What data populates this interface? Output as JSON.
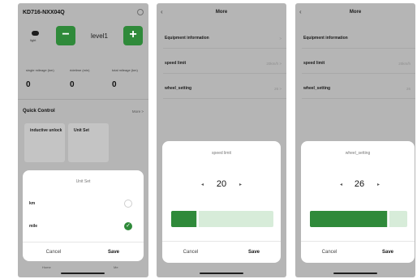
{
  "phone1": {
    "device_title": "KD716-NXX04Q",
    "light_label": "light",
    "level_label": "level1",
    "minus_label": "−",
    "plus_label": "+",
    "stats": [
      {
        "label": "single mileage (km)",
        "value": "0"
      },
      {
        "label": "ridetime (min)",
        "value": "0"
      },
      {
        "label": "total mileage (km)",
        "value": "0"
      }
    ],
    "quick_control": {
      "title": "Quick Control",
      "more": "More >"
    },
    "quick_cards": [
      {
        "label": "inductive unlock"
      },
      {
        "label": "Unit Set"
      }
    ],
    "unit_sheet": {
      "title": "Unit Set",
      "options": [
        {
          "label": "km",
          "selected": false
        },
        {
          "label": "mile",
          "selected": true
        }
      ],
      "cancel": "Cancel",
      "save": "Save"
    },
    "tabbar": [
      "Home",
      "Me"
    ]
  },
  "phone2": {
    "title": "More",
    "rows": [
      {
        "label": "Equipment information",
        "value": ">"
      },
      {
        "label": "speed limit",
        "value": "20km/h >"
      },
      {
        "label": "wheel_setting",
        "value": "26 >"
      }
    ],
    "dialog": {
      "title": "speed limit",
      "value": "20",
      "dec": "◂",
      "inc": "▸",
      "fill_fraction": 0.25,
      "cancel": "Cancel",
      "save": "Save"
    }
  },
  "phone3": {
    "title": "More",
    "rows": [
      {
        "label": "Equipment information",
        "value": ""
      },
      {
        "label": "speed limit",
        "value": "20km/h"
      },
      {
        "label": "wheel_setting",
        "value": "26"
      }
    ],
    "dialog": {
      "title": "wheel_setting",
      "value": "26",
      "dec": "◂",
      "inc": "▸",
      "fill_fraction": 0.8,
      "cancel": "Cancel",
      "save": "Save"
    }
  },
  "colors": {
    "accent": "#2f8a3a",
    "accent_light": "#d7ecd9",
    "overlay_gray": "#b5b5b5"
  },
  "icons": {
    "back": "‹",
    "check": "✓"
  }
}
